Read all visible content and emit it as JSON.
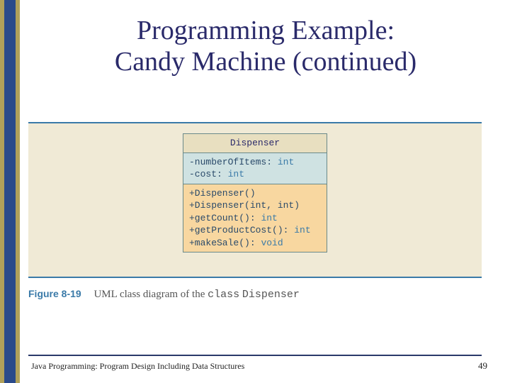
{
  "title_line1": "Programming Example:",
  "title_line2": "Candy Machine (continued)",
  "uml": {
    "class_name": "Dispenser",
    "fields": [
      {
        "name": "-numberOfItems:",
        "type": "int"
      },
      {
        "name": "-cost:",
        "type": "int"
      }
    ],
    "methods": [
      {
        "sig": "+Dispenser()",
        "ret": ""
      },
      {
        "sig": "+Dispenser(int, int)",
        "ret": ""
      },
      {
        "sig": "+getCount():",
        "ret": "int"
      },
      {
        "sig": "+getProductCost():",
        "ret": "int"
      },
      {
        "sig": "+makeSale():",
        "ret": "void"
      }
    ]
  },
  "caption": {
    "fig_label": "Figure 8-19",
    "text_pre": "UML class diagram of the ",
    "mono1": "class",
    "mono2": "Dispenser"
  },
  "footer": "Java Programming: Program Design Including Data Structures",
  "page": "49",
  "colors": {
    "accent_blue": "#3a7aa8",
    "title_navy": "#2a2a6a",
    "cream": "#f0ead6",
    "uml_header": "#e8dfc0",
    "uml_fields": "#cfe2e2",
    "uml_methods": "#f8d7a0"
  }
}
